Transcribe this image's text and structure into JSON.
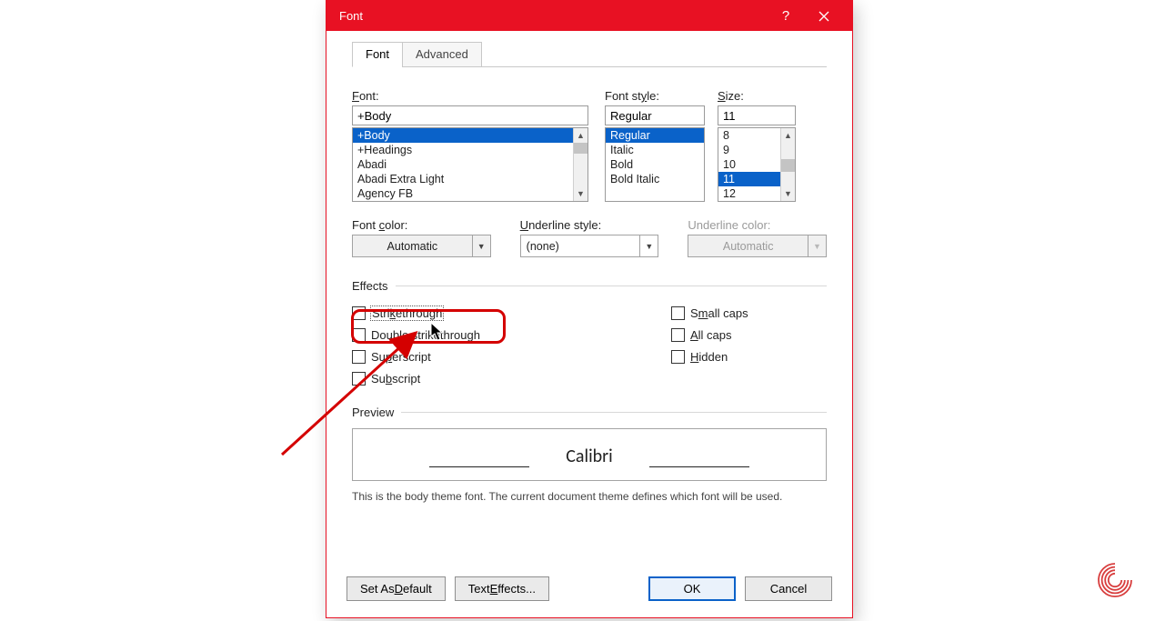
{
  "dialog": {
    "title": "Font",
    "tabs": {
      "font": "Font",
      "advanced": "Advanced",
      "active": "font"
    },
    "labels": {
      "font": "Font:",
      "font_style": "Font style:",
      "size": "Size:",
      "font_color": "Font color:",
      "underline_style": "Underline style:",
      "underline_color": "Underline color:",
      "effects": "Effects",
      "preview": "Preview"
    },
    "font": {
      "value": "+Body",
      "list": [
        "+Body",
        "+Headings",
        "Abadi",
        "Abadi Extra Light",
        "Agency FB"
      ],
      "selected_index": 0
    },
    "style": {
      "value": "Regular",
      "list": [
        "Regular",
        "Italic",
        "Bold",
        "Bold Italic"
      ],
      "selected_index": 0
    },
    "size": {
      "value": "11",
      "list": [
        "8",
        "9",
        "10",
        "11",
        "12"
      ],
      "selected_index": 3
    },
    "font_color": "Automatic",
    "underline_style": "(none)",
    "underline_color": "Automatic",
    "effects": {
      "strikethrough": "Strikethrough",
      "double_strike": "Double strikethrough",
      "superscript": "Superscript",
      "subscript": "Subscript",
      "small_caps": "Small caps",
      "all_caps": "All caps",
      "hidden": "Hidden"
    },
    "preview_font": "Calibri",
    "preview_desc": "This is the body theme font. The current document theme defines which font will be used.",
    "buttons": {
      "set_default": "Set As Default",
      "text_effects": "Text Effects...",
      "ok": "OK",
      "cancel": "Cancel"
    }
  },
  "annotation": {
    "highlight_target": "strikethrough-checkbox"
  }
}
